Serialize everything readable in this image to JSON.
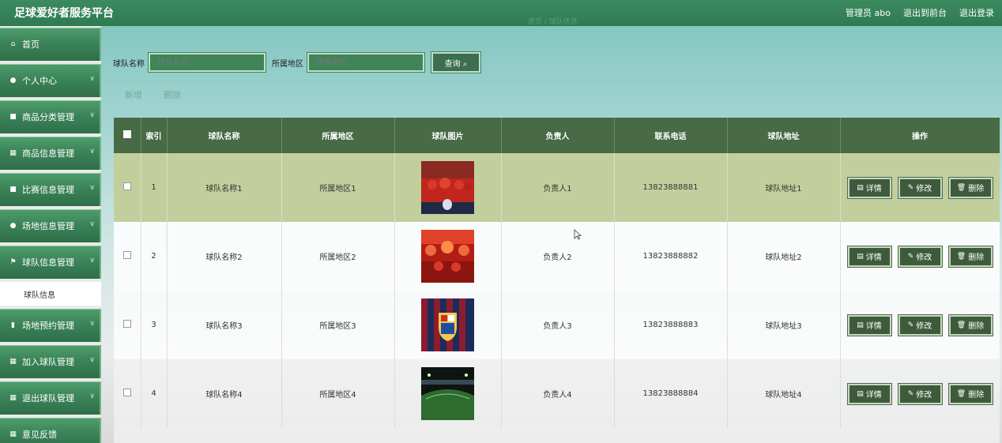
{
  "header": {
    "app_title": "足球爱好者服务平台",
    "admin_label": "管理员 abo",
    "back_to_front": "退出到前台",
    "logout": "退出登录",
    "breadcrumb": "首页 / 球队信息"
  },
  "sidebar": {
    "items": [
      {
        "label": "首页",
        "icon": "home-icon"
      },
      {
        "label": "个人中心",
        "icon": "user-icon"
      },
      {
        "label": "商品分类管理",
        "icon": "box-icon"
      },
      {
        "label": "商品信息管理",
        "icon": "grid-icon"
      },
      {
        "label": "比赛信息管理",
        "icon": "box-icon"
      },
      {
        "label": "场地信息管理",
        "icon": "user-icon"
      },
      {
        "label": "球队信息管理",
        "icon": "flag-icon"
      },
      {
        "label": "场地预约管理",
        "icon": "bar-chart-icon"
      },
      {
        "label": "加入球队管理",
        "icon": "grid-icon"
      },
      {
        "label": "退出球队管理",
        "icon": "grid-icon"
      },
      {
        "label": "意见反馈",
        "icon": "grid-icon"
      }
    ],
    "submenu_label": "球队信息"
  },
  "search": {
    "team_name_label": "球队名称",
    "team_name_placeholder": "球队名称",
    "region_label": "所属地区",
    "region_placeholder": "所属地区",
    "query_button": "查询"
  },
  "actions": {
    "add": "新增",
    "delete": "删除"
  },
  "table": {
    "headers": [
      "索引",
      "球队名称",
      "所属地区",
      "球队图片",
      "负责人",
      "联系电话",
      "球队地址",
      "操作"
    ],
    "rows": [
      {
        "index": "1",
        "name": "球队名称1",
        "region": "所属地区1",
        "manager": "负责人1",
        "phone": "13823888881",
        "address": "球队地址1"
      },
      {
        "index": "2",
        "name": "球队名称2",
        "region": "所属地区2",
        "manager": "负责人2",
        "phone": "13823888882",
        "address": "球队地址2"
      },
      {
        "index": "3",
        "name": "球队名称3",
        "region": "所属地区3",
        "manager": "负责人3",
        "phone": "13823888883",
        "address": "球队地址3"
      },
      {
        "index": "4",
        "name": "球队名称4",
        "region": "所属地区4",
        "manager": "负责人4",
        "phone": "13823888884",
        "address": "球队地址4"
      }
    ],
    "op_detail": "详情",
    "op_edit": "修改",
    "op_delete": "删除"
  },
  "colors": {
    "header_bg": "#2f7a52",
    "table_head": "#486a44",
    "selected_row": "#c2cf9d",
    "button": "#3d5b3b"
  }
}
